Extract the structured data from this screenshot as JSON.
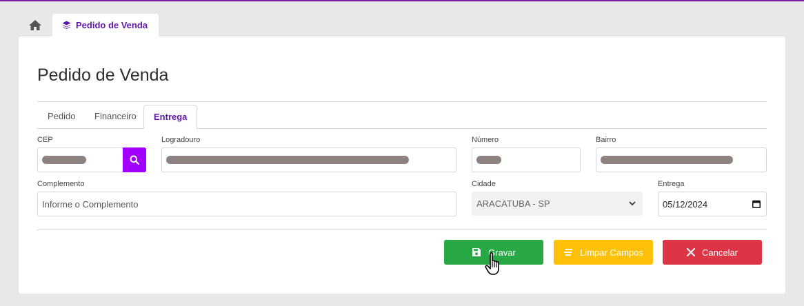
{
  "top_tabs": {
    "home_icon": "home-icon",
    "doc_icon": "layers-icon",
    "doc_label": "Pedido de Venda"
  },
  "page": {
    "title": "Pedido de Venda"
  },
  "tabs": [
    {
      "label": "Pedido"
    },
    {
      "label": "Financeiro"
    },
    {
      "label": "Entrega",
      "active": true
    }
  ],
  "fields": {
    "cep": {
      "label": "CEP",
      "search_icon": "search-icon"
    },
    "logradouro": {
      "label": "Logradouro"
    },
    "numero": {
      "label": "Número"
    },
    "bairro": {
      "label": "Bairro"
    },
    "complemento": {
      "label": "Complemento",
      "placeholder": "Informe o Complemento"
    },
    "cidade": {
      "label": "Cidade",
      "value": "ARACATUBA - SP"
    },
    "entrega": {
      "label": "Entrega",
      "value": "05/12/2024"
    }
  },
  "buttons": {
    "save": "Gravar",
    "clear": "Limpar Campos",
    "cancel": "Cancelar"
  },
  "colors": {
    "accent": "#5e17a8",
    "search_button": "#a100ff",
    "save": "#28a745",
    "clear": "#ffc107",
    "cancel": "#dc3545"
  }
}
